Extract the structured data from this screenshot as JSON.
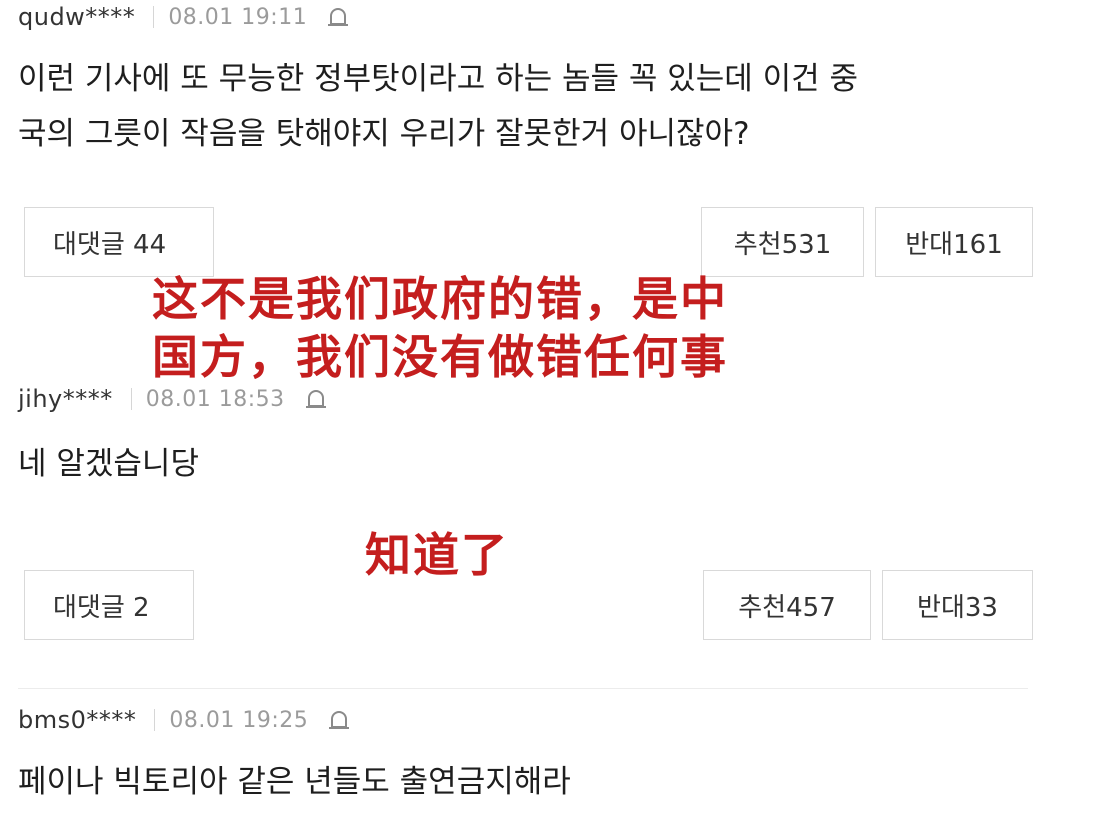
{
  "comments": [
    {
      "user": "qudw****",
      "time": "08.01 19:11",
      "text_lines": [
        "이런 기사에 또 무능한 정부탓이라고 하는 놈들 꼭 있는데 이건 중",
        "국의 그릇이 작음을 탓해야지 우리가 잘못한거 아니잖아?"
      ],
      "reply_label": "대댓글 44",
      "like_label": "추천531",
      "dislike_label": "반대161"
    },
    {
      "user": "jihy****",
      "time": "08.01 18:53",
      "text_lines": [
        "네 알겠습니당"
      ],
      "reply_label": "대댓글 2",
      "like_label": "추천457",
      "dislike_label": "반대33"
    },
    {
      "user": "bms0****",
      "time": "08.01 19:25",
      "text_lines": [
        "페이나 빅토리아 같은 년들도 출연금지해라"
      ]
    }
  ],
  "overlays": {
    "first_lines": [
      "这不是我们政府的错，是中",
      "国方，我们没有做错任何事"
    ],
    "second": "知道了"
  },
  "icons": {
    "report": "bell-report-icon"
  },
  "colors": {
    "overlay_text": "#c41e1e",
    "meta_time": "#9b9b9b",
    "border": "#d9d9d9"
  }
}
